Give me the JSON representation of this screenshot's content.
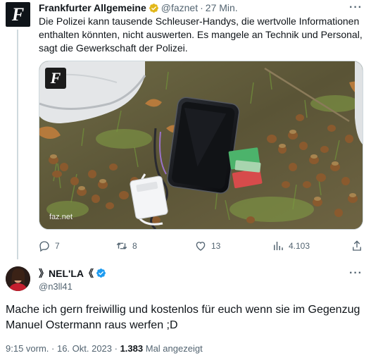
{
  "parent_tweet": {
    "author_name": "Frankfurter Allgemeine",
    "handle": "@faznet",
    "separator": "·",
    "time": "27 Min.",
    "avatar_letter": "F",
    "text": "Die Polizei kann tausende Schleuser-Handys, die wertvolle Informationen enthalten könnten, nicht auswerten. Es mangele an Technik und Personal, sagt die Gewerkschaft der Polizei.",
    "media": {
      "logo_letter": "F",
      "watermark": "faz.net"
    },
    "actions": {
      "reply_count": "7",
      "retweet_count": "8",
      "like_count": "13",
      "view_count": "4.103"
    }
  },
  "main_tweet": {
    "display_name": "》NELʹLA《",
    "handle": "@n3ll41",
    "text": "Mache ich gern freiwillig und kostenlos für euch wenn sie im Gegenzug Manuel Ostermann raus werfen ;D",
    "timestamp": "9:15 vorm. · 16. Okt. 2023 · ",
    "views": "1.383",
    "views_label": " Mal angezeigt"
  },
  "colors": {
    "text_primary": "#0f1419",
    "text_secondary": "#536471",
    "verified_gold": "#e2b719",
    "verified_blue": "#1d9bf0",
    "divider": "#cfd9de"
  },
  "icons": [
    "reply-icon",
    "retweet-icon",
    "like-icon",
    "views-icon",
    "share-icon",
    "verified-gold-badge-icon",
    "verified-blue-badge-icon",
    "more-options-icon"
  ]
}
